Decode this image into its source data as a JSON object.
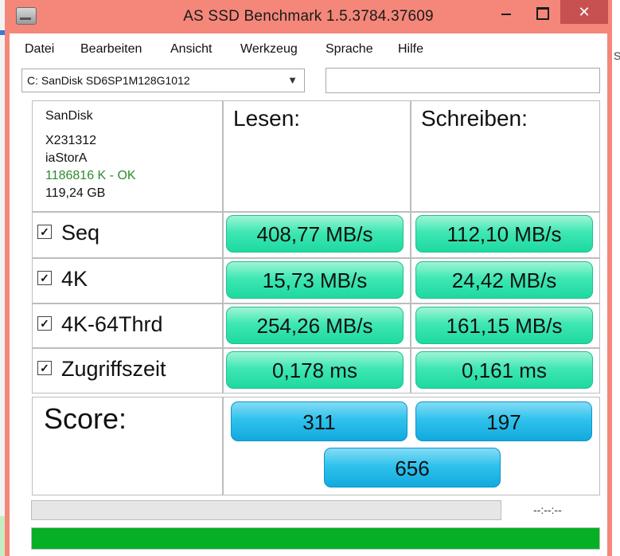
{
  "window": {
    "title": "AS SSD Benchmark 1.5.3784.37609",
    "controls": {
      "minimize": "minimize",
      "maximize": "maximize",
      "close": "✕"
    }
  },
  "menu": [
    "Datei",
    "Bearbeiten",
    "Ansicht",
    "Werkzeug",
    "Sprache",
    "Hilfe"
  ],
  "drive_select": {
    "value": "C: SanDisk SD6SP1M128G1012",
    "options_visible": [
      "C: SanDisk SD6SP1M128G1012"
    ]
  },
  "aux_input": {
    "value": ""
  },
  "drive_info": {
    "vendor": "SanDisk",
    "firmware": "X231312",
    "driver": "iaStorA",
    "alignment": "1186816 K - OK",
    "capacity": "119,24 GB"
  },
  "columns": {
    "read": "Lesen:",
    "write": "Schreiben:"
  },
  "tests": [
    {
      "label": "Seq",
      "checked": true,
      "read": "408,77 MB/s",
      "write": "112,10 MB/s"
    },
    {
      "label": "4K",
      "checked": true,
      "read": "15,73 MB/s",
      "write": "24,42 MB/s"
    },
    {
      "label": "4K-64Thrd",
      "checked": true,
      "read": "254,26 MB/s",
      "write": "161,15 MB/s"
    },
    {
      "label": "Zugriffszeit",
      "checked": true,
      "read": "0,178 ms",
      "write": "0,161 ms"
    }
  ],
  "score": {
    "label": "Score:",
    "read": "311",
    "write": "197",
    "total": "656"
  },
  "status": {
    "time": "--:--:--",
    "progress_percent": 100,
    "sub_progress_percent": 0
  },
  "background": {
    "right_edge_text": "S"
  },
  "colors": {
    "window_frame": "#f4877a",
    "result_green": "#2de3ad",
    "score_blue": "#22b8e8",
    "progress_green": "#06b025",
    "ok_text": "#2e8b2e"
  }
}
